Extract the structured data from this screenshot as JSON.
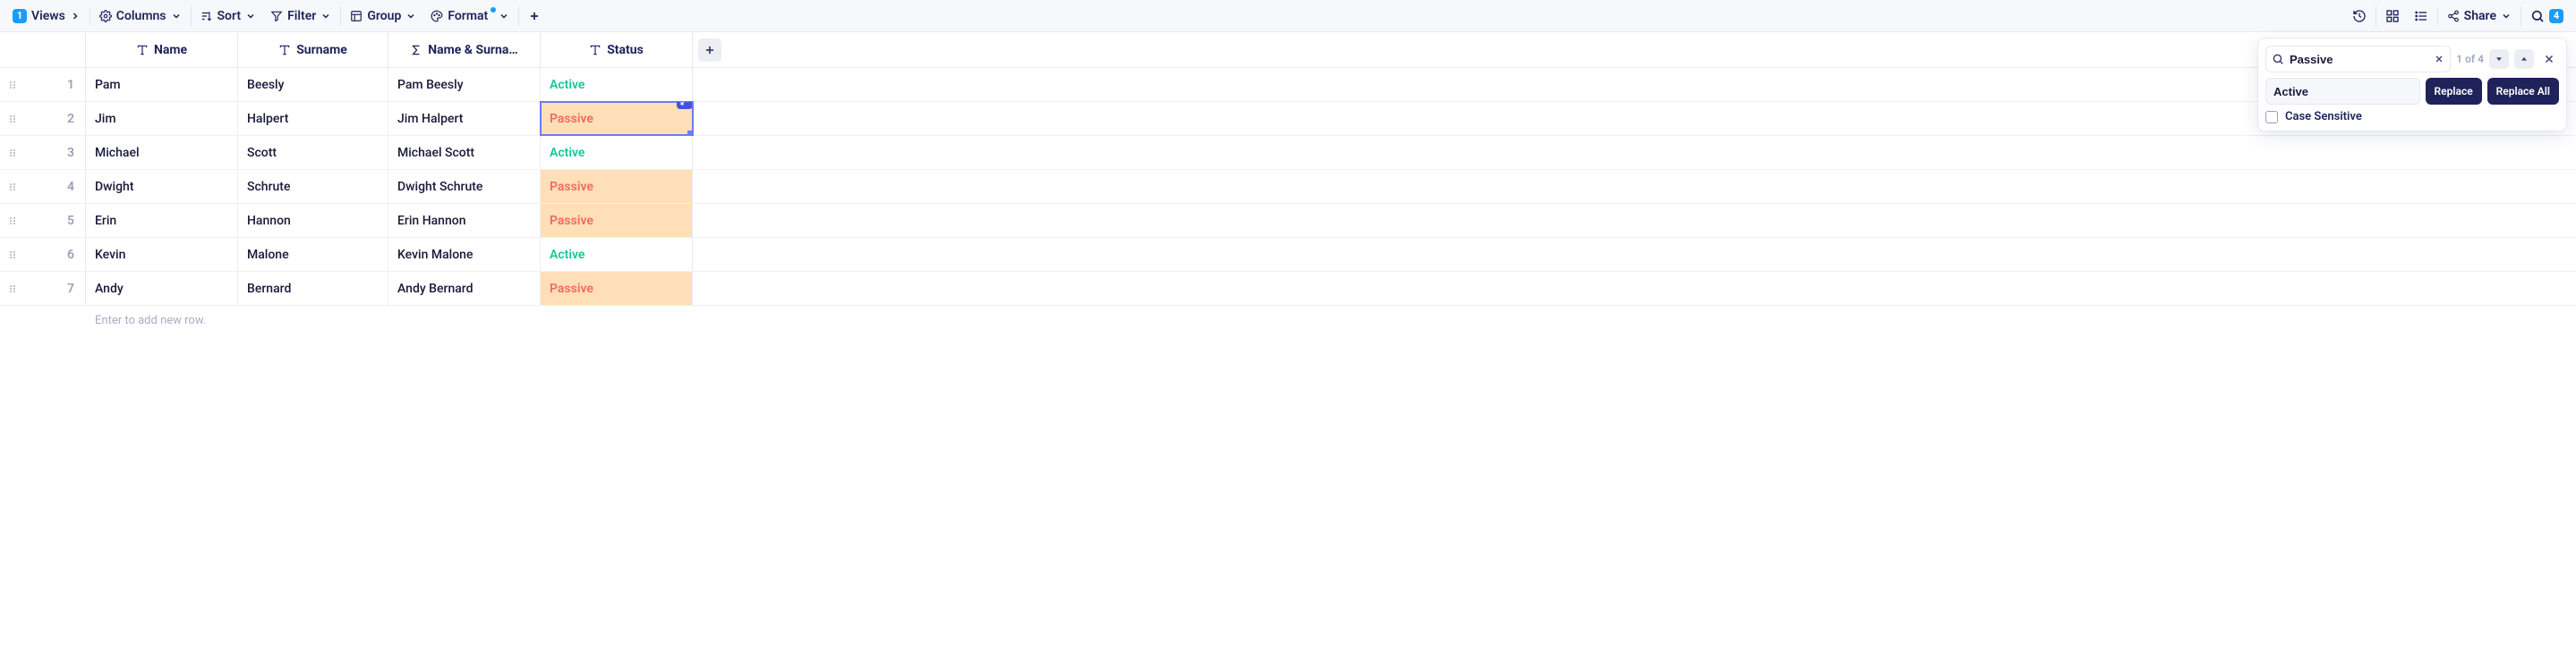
{
  "toolbar": {
    "views_badge": "1",
    "views_label": "Views",
    "columns_label": "Columns",
    "sort_label": "Sort",
    "filter_label": "Filter",
    "group_label": "Group",
    "format_label": "Format",
    "share_label": "Share",
    "search_badge": "4"
  },
  "columns": [
    {
      "name": "Name",
      "type": "text"
    },
    {
      "name": "Surname",
      "type": "text"
    },
    {
      "name": "Name & Surna…",
      "type": "formula"
    },
    {
      "name": "Status",
      "type": "text"
    }
  ],
  "rows": [
    {
      "num": "1",
      "name": "Pam",
      "surname": "Beesly",
      "namesurname": "Pam Beesly",
      "status": "Active"
    },
    {
      "num": "2",
      "name": "Jim",
      "surname": "Halpert",
      "namesurname": "Jim Halpert",
      "status": "Passive"
    },
    {
      "num": "3",
      "name": "Michael",
      "surname": "Scott",
      "namesurname": "Michael Scott",
      "status": "Active"
    },
    {
      "num": "4",
      "name": "Dwight",
      "surname": "Schrute",
      "namesurname": "Dwight Schrute",
      "status": "Passive"
    },
    {
      "num": "5",
      "name": "Erin",
      "surname": "Hannon",
      "namesurname": "Erin Hannon",
      "status": "Passive"
    },
    {
      "num": "6",
      "name": "Kevin",
      "surname": "Malone",
      "namesurname": "Kevin Malone",
      "status": "Active"
    },
    {
      "num": "7",
      "name": "Andy",
      "surname": "Bernard",
      "namesurname": "Andy Bernard",
      "status": "Passive"
    }
  ],
  "new_row_hint": "Enter to add new row.",
  "find": {
    "search_value": "Passive",
    "count_text": "1 of 4",
    "replace_value": "Active",
    "replace_label": "Replace",
    "replace_all_label": "Replace All",
    "case_sensitive_label": "Case Sensitive"
  }
}
